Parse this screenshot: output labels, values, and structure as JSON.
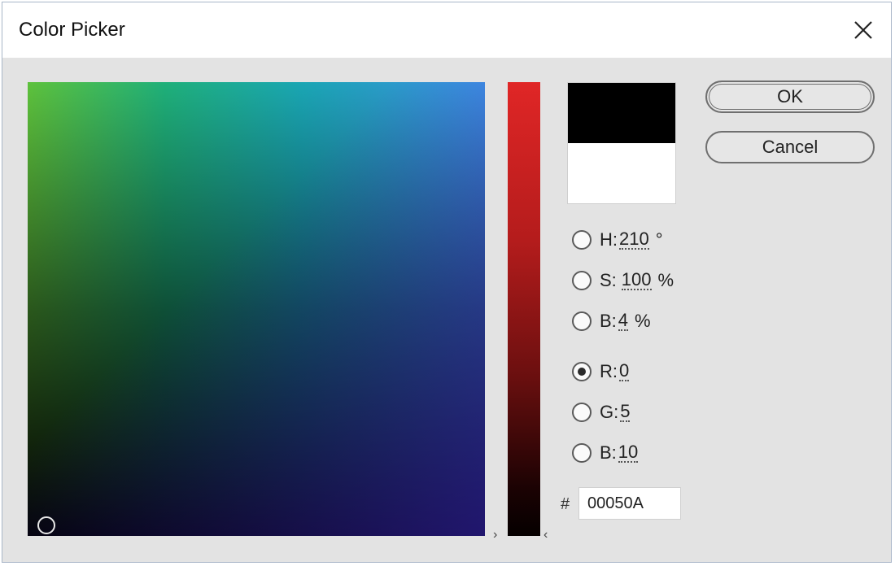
{
  "window": {
    "title": "Color Picker"
  },
  "buttons": {
    "ok_label": "OK",
    "cancel_label": "Cancel"
  },
  "hsb": {
    "h_label": "H:",
    "h_value": "210",
    "h_unit": "°",
    "s_label": "S:",
    "s_value": "100",
    "s_unit": "%",
    "b_label": "B:",
    "b_value": "4",
    "b_unit": "%"
  },
  "rgb": {
    "r_label": "R:",
    "r_value": "0",
    "g_label": "G:",
    "g_value": "5",
    "b_label": "B:",
    "b_value": "10",
    "selected": "R"
  },
  "hex": {
    "prefix": "#",
    "value": "00050A"
  },
  "swatch": {
    "new_color": "#000000",
    "current_color": "#ffffff"
  },
  "icons": {
    "close": "close-icon",
    "slider_left_marker": "chevron-right-icon",
    "slider_right_marker": "chevron-left-icon"
  }
}
